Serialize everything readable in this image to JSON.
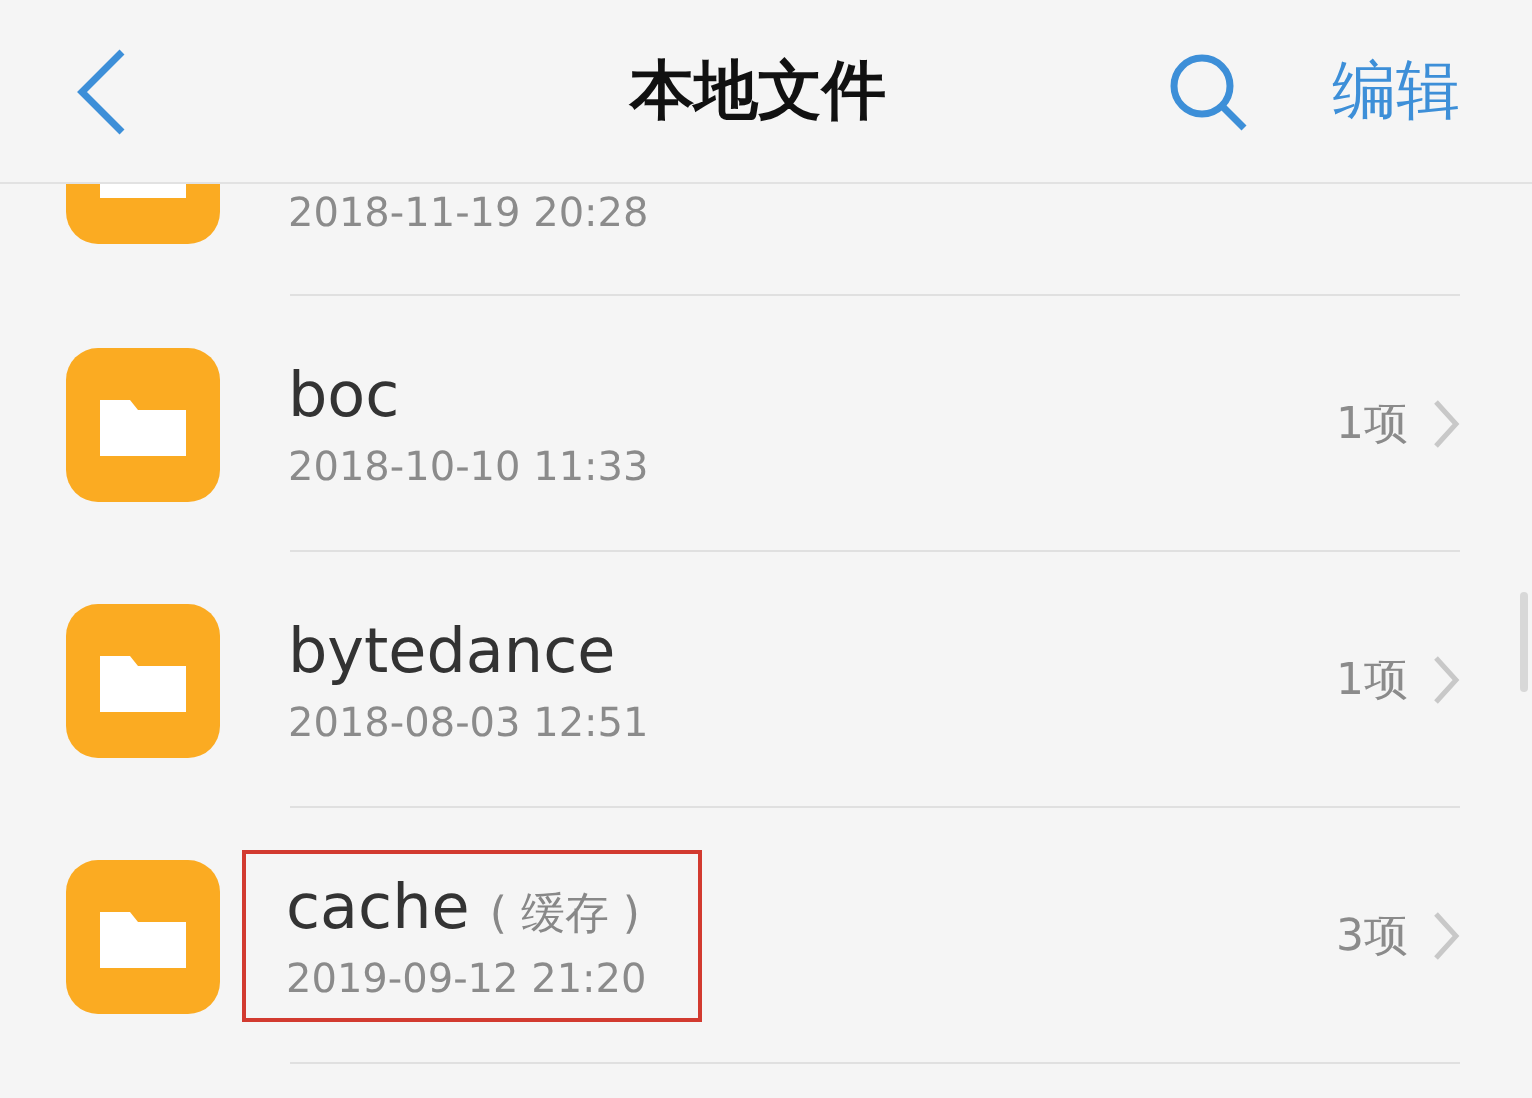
{
  "header": {
    "title": "本地文件",
    "edit_label": "编辑"
  },
  "rows": [
    {
      "kind": "partial",
      "date": "2018-11-19 20:28",
      "highlighted": false
    },
    {
      "kind": "folder",
      "name": "boc",
      "date": "2018-10-10 11:33",
      "count": "1项",
      "highlighted": false
    },
    {
      "kind": "folder",
      "name": "bytedance",
      "date": "2018-08-03 12:51",
      "count": "1项",
      "highlighted": false
    },
    {
      "kind": "folder",
      "name": "cache",
      "note": "( 缓存 )",
      "date": "2019-09-12 21:20",
      "count": "3项",
      "highlighted": true
    }
  ]
}
